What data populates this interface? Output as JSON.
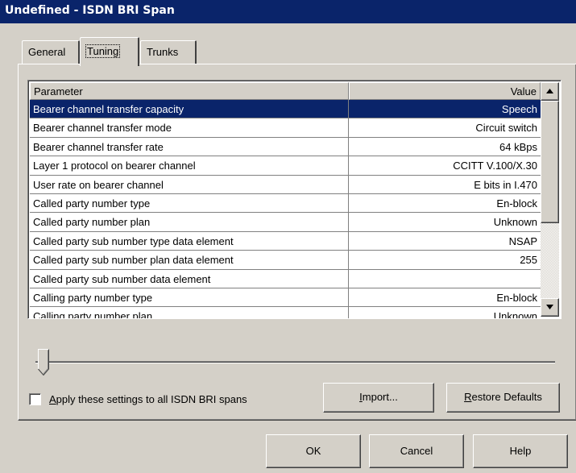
{
  "window": {
    "title": "Undefined - ISDN BRI Span"
  },
  "tabs": [
    {
      "label": "General",
      "active": false
    },
    {
      "label": "Tuning",
      "active": true
    },
    {
      "label": "Trunks",
      "active": false
    }
  ],
  "grid": {
    "columns": {
      "parameter": "Parameter",
      "value": "Value"
    },
    "rows": [
      {
        "parameter": "Bearer channel transfer capacity",
        "value": "Speech"
      },
      {
        "parameter": "Bearer channel transfer mode",
        "value": "Circuit switch"
      },
      {
        "parameter": "Bearer channel transfer rate",
        "value": "64 kBps"
      },
      {
        "parameter": "Layer 1 protocol on bearer channel",
        "value": "CCITT V.100/X.30"
      },
      {
        "parameter": "User rate on bearer channel",
        "value": "E bits in I.470"
      },
      {
        "parameter": "Called party number type",
        "value": "En-block"
      },
      {
        "parameter": "Called party number plan",
        "value": "Unknown"
      },
      {
        "parameter": "Called party sub number type data element",
        "value": "NSAP"
      },
      {
        "parameter": "Called party sub number plan data element",
        "value": "255"
      },
      {
        "parameter": "Called party sub number data element",
        "value": ""
      },
      {
        "parameter": "Calling party number type",
        "value": "En-block"
      },
      {
        "parameter": "Calling party number plan",
        "value": "Unknown"
      }
    ],
    "selected_index": 0
  },
  "slider": {
    "level": 0
  },
  "options": {
    "apply_all_label": "Apply these settings to all ISDN BRI spans",
    "apply_all_checked": false
  },
  "buttons": {
    "import": "Import...",
    "restore_defaults": "Restore Defaults",
    "ok": "OK",
    "cancel": "Cancel",
    "help": "Help"
  },
  "colors": {
    "titlebar": "#0a246a",
    "selection": "#0a246a",
    "face": "#d4d0c8"
  },
  "icons": {
    "scroll_up": "triangle-up",
    "scroll_down": "triangle-down"
  }
}
